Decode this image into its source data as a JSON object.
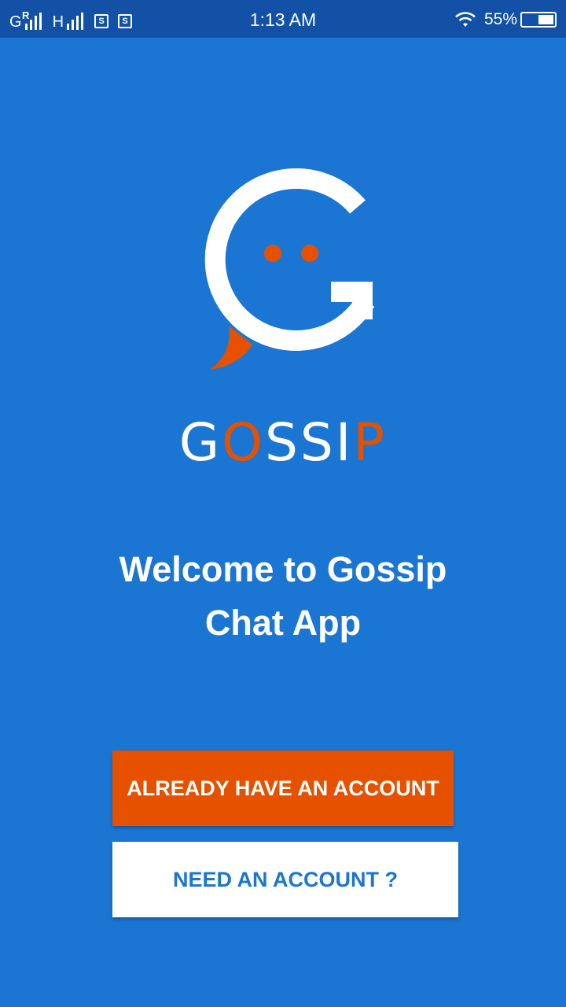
{
  "status_bar": {
    "network_1": "G",
    "network_1_sup": "R",
    "network_2": "H",
    "sim_1": "S",
    "sim_2": "S",
    "time": "1:13 AM",
    "battery_percent": "55%",
    "battery_level": 0.55,
    "icons": [
      "signal-icon",
      "sim-icon",
      "wifi-icon",
      "battery-icon"
    ]
  },
  "logo": {
    "icon": "gossip-chat-logo-icon",
    "brand_letters": [
      "G",
      "O",
      "S",
      "S",
      "I",
      "P"
    ],
    "colors": {
      "primary": "#ffffff",
      "accent": "#e65100"
    }
  },
  "welcome": {
    "line1": "Welcome to Gossip",
    "line2": "Chat App"
  },
  "buttons": {
    "login_label": "ALREADY HAVE AN ACCOUNT",
    "register_label": "NEED AN ACCOUNT ?"
  },
  "colors": {
    "background": "#1b76d3",
    "status_bar": "#1251a6",
    "accent": "#e65100"
  }
}
